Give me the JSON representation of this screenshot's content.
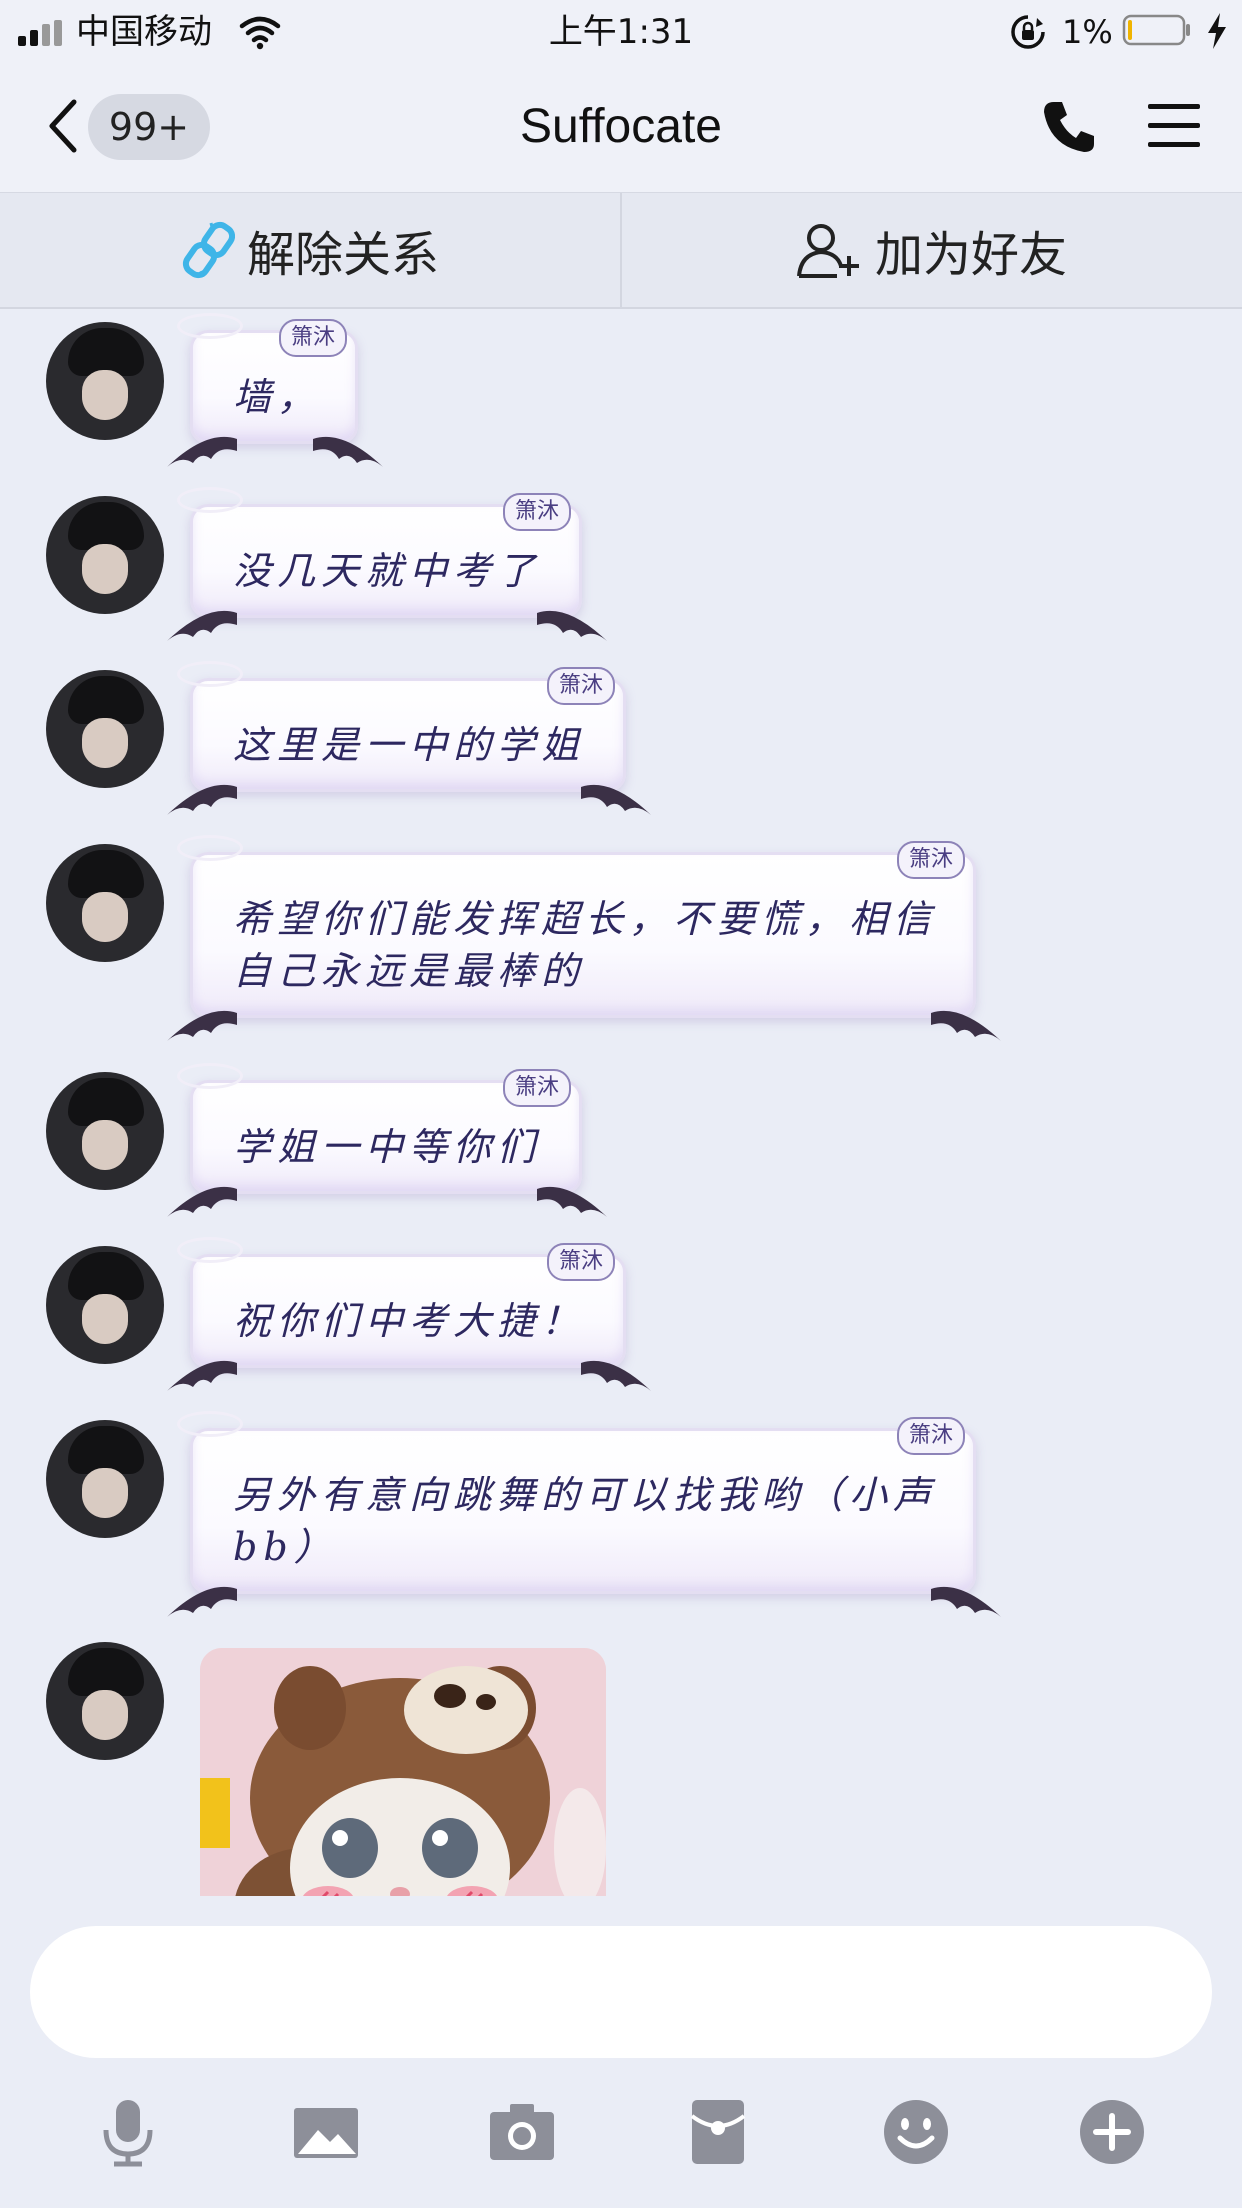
{
  "status_bar": {
    "carrier": "中国移动",
    "time": "上午1:31",
    "battery_percent": "1%",
    "icons": [
      "signal-icon",
      "wifi-icon",
      "rotation-lock-icon",
      "battery-icon",
      "charging-icon"
    ]
  },
  "nav": {
    "unread_badge": "99+",
    "title": "Suffocate",
    "icons": [
      "back-chevron-icon",
      "phone-icon",
      "menu-icon"
    ]
  },
  "actions": {
    "unlink_label": "解除关系",
    "add_friend_label": "加为好友"
  },
  "messages": [
    {
      "text": "墙，",
      "tag": "箫沐"
    },
    {
      "text": "没几天就中考了",
      "tag": "箫沐"
    },
    {
      "text": "这里是一中的学姐",
      "tag": "箫沐"
    },
    {
      "text": "希望你们能发挥超长，不要慌，相信自己永远是最棒的",
      "tag": "箫沐"
    },
    {
      "text": "学姐一中等你们",
      "tag": "箫沐"
    },
    {
      "text": "祝你们中考大捷！",
      "tag": "箫沐"
    },
    {
      "text": "另外有意向跳舞的可以找我哟（小声bb）",
      "tag": "箫沐"
    }
  ],
  "sticker": {
    "kind": "cat-in-bear-hat-sticker"
  },
  "input": {
    "value": "",
    "placeholder": ""
  },
  "toolbar": [
    "microphone-icon",
    "image-icon",
    "camera-icon",
    "red-packet-icon",
    "emoji-icon",
    "plus-icon"
  ],
  "colors": {
    "background": "#eaedf6",
    "bubble_text": "#2d2860",
    "bubble_tag_border": "#8d83b8",
    "toolbar_icon": "#8d8f99",
    "link_icon": "#3fb5e8"
  }
}
